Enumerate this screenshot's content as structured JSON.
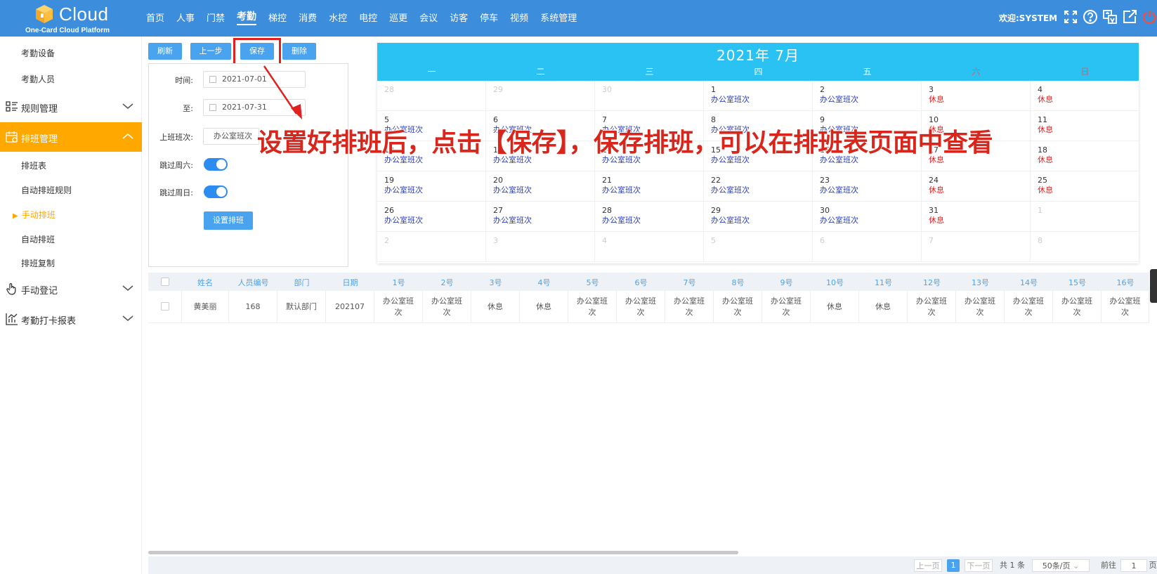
{
  "header": {
    "logo_text": "Cloud",
    "logo_subtitle": "One-Card Cloud Platform",
    "nav": [
      "首页",
      "人事",
      "门禁",
      "考勤",
      "梯控",
      "消费",
      "水控",
      "电控",
      "巡更",
      "会议",
      "访客",
      "停车",
      "视频",
      "系统管理"
    ],
    "welcome": "欢迎:SYSTEM",
    "icons": [
      "fullscreen-icon",
      "help-icon",
      "translate-icon",
      "external-link-icon",
      "power-icon"
    ]
  },
  "sidebar": {
    "items": [
      {
        "label": "考勤设备"
      },
      {
        "label": "考勤人员"
      }
    ],
    "groups": {
      "rules": "规则管理",
      "schedule": "排班管理",
      "manual": "手动登记",
      "report": "考勤打卡报表"
    },
    "schedule_items": [
      "排班表",
      "自动排班规则",
      "手动排班",
      "自动排班",
      "排班复制"
    ]
  },
  "toolbar": {
    "refresh": "刷新",
    "prev": "上一步",
    "save": "保存",
    "delete": "删除"
  },
  "form": {
    "time_label": "时间:",
    "time_value": "2021-07-01",
    "to_label": "至:",
    "to_value": "2021-07-31",
    "shift_label": "上班班次:",
    "shift_value": "办公室班次",
    "skip_sat_label": "跳过周六:",
    "skip_sun_label": "跳过周日:",
    "set_button": "设置排班"
  },
  "calendar": {
    "title": "2021年  7月",
    "weekdays": [
      "一",
      "二",
      "三",
      "四",
      "五",
      "六",
      "日"
    ],
    "shift_name": "办公室班次",
    "rest_name": "休息"
  },
  "annotation": "设置好排班后，点击【保存】，保存排班，可以在排班表页面中查看",
  "table": {
    "headers": [
      "姓名",
      "人员编号",
      "部门",
      "日期",
      "1号",
      "2号",
      "3号",
      "4号",
      "5号",
      "6号",
      "7号",
      "8号",
      "9号",
      "10号",
      "11号",
      "12号",
      "13号",
      "14号",
      "15号",
      "16号"
    ],
    "row": [
      "黄美丽",
      "168",
      "默认部门",
      "202107",
      "办公室班\n次",
      "办公室班\n次",
      "休息",
      "休息",
      "办公室班\n次",
      "办公室班\n次",
      "办公室班\n次",
      "办公室班\n次",
      "办公室班\n次",
      "休息",
      "休息",
      "办公室班\n次",
      "办公室班\n次",
      "办公室班\n次",
      "办公室班\n次",
      "办公室班\n次"
    ]
  },
  "pager": {
    "prev": "上一页",
    "current": "1",
    "next": "下一页",
    "total": "共 1 条",
    "page_size": "50条/页",
    "goto": "前往",
    "goto_value": "1",
    "page_unit": "页"
  },
  "colors": {
    "header": "#3c8ddb",
    "active_menu": "#ffa800",
    "calendar_head": "#29c2f2",
    "shift_text": "#2c3fb4",
    "rest_text": "#e02121",
    "annotation": "#d8261c"
  }
}
